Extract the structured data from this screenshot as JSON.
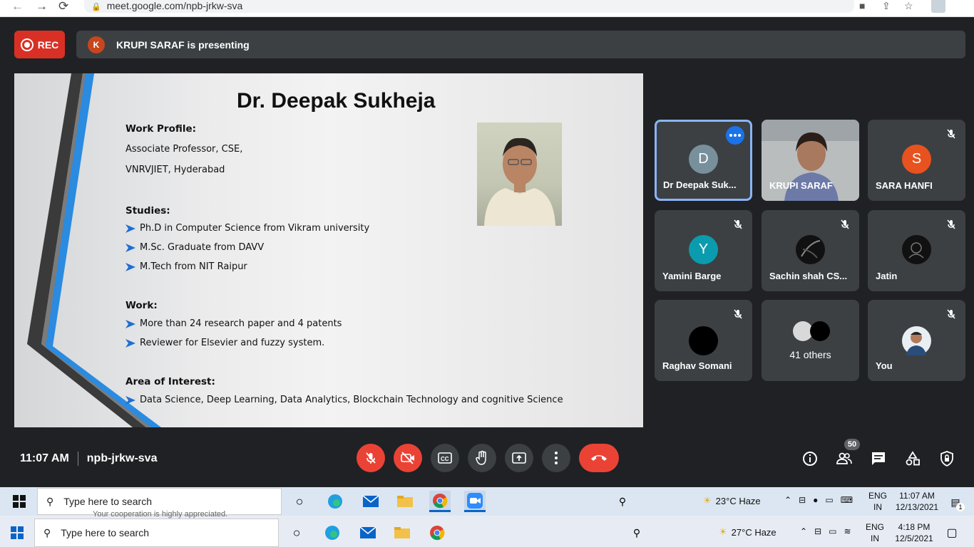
{
  "browser": {
    "url": "meet.google.com/npb-jrkw-sva"
  },
  "meeting": {
    "rec_label": "REC",
    "presenter_initial": "K",
    "presenting_text": "KRUPI SARAF is presenting",
    "time": "11:07 AM",
    "code": "npb-jrkw-sva",
    "people_count": "50"
  },
  "slide": {
    "title": "Dr. Deepak Sukheja",
    "work_profile_heading": "Work Profile:",
    "work_profile_lines": [
      "Associate Professor, CSE,",
      "VNRVJIET, Hyderabad"
    ],
    "studies_heading": "Studies:",
    "studies": [
      "Ph.D in Computer Science from Vikram university",
      "M.Sc. Graduate from DAVV",
      "M.Tech from NIT Raipur"
    ],
    "work_heading": "Work:",
    "work": [
      "More than 24 research paper and 4 patents",
      "Reviewer for Elsevier and fuzzy system."
    ],
    "interest_heading": "Area of Interest:",
    "interest": [
      "Data Science, Deep Learning, Data Analytics, Blockchain Technology and cognitive Science"
    ]
  },
  "participants": [
    {
      "name": "Dr Deepak Suk...",
      "initial": "D",
      "color": "#78909c"
    },
    {
      "name": "KRUPI SARAF"
    },
    {
      "name": "SARA HANFI",
      "initial": "S",
      "color": "#e8521e"
    },
    {
      "name": "Yamini Barge",
      "initial": "Y",
      "color": "#0a9cae"
    },
    {
      "name": "Sachin shah CS..."
    },
    {
      "name": "Jatin"
    },
    {
      "name": "Raghav Somani"
    },
    {
      "name": "41 others"
    },
    {
      "name": "You"
    }
  ],
  "taskbar1": {
    "search_placeholder": "Type here to search",
    "weather": "23°C  Haze",
    "lang1": "ENG",
    "lang2": "IN",
    "time": "11:07 AM",
    "date": "12/13/2021",
    "notif": "1"
  },
  "taskbar2": {
    "search_placeholder": "Type here to search",
    "weather": "27°C  Haze",
    "lang1": "ENG",
    "lang2": "IN",
    "time": "4:18 PM",
    "date": "12/5/2021",
    "peek_text": "Your cooperation is highly appreciated."
  }
}
